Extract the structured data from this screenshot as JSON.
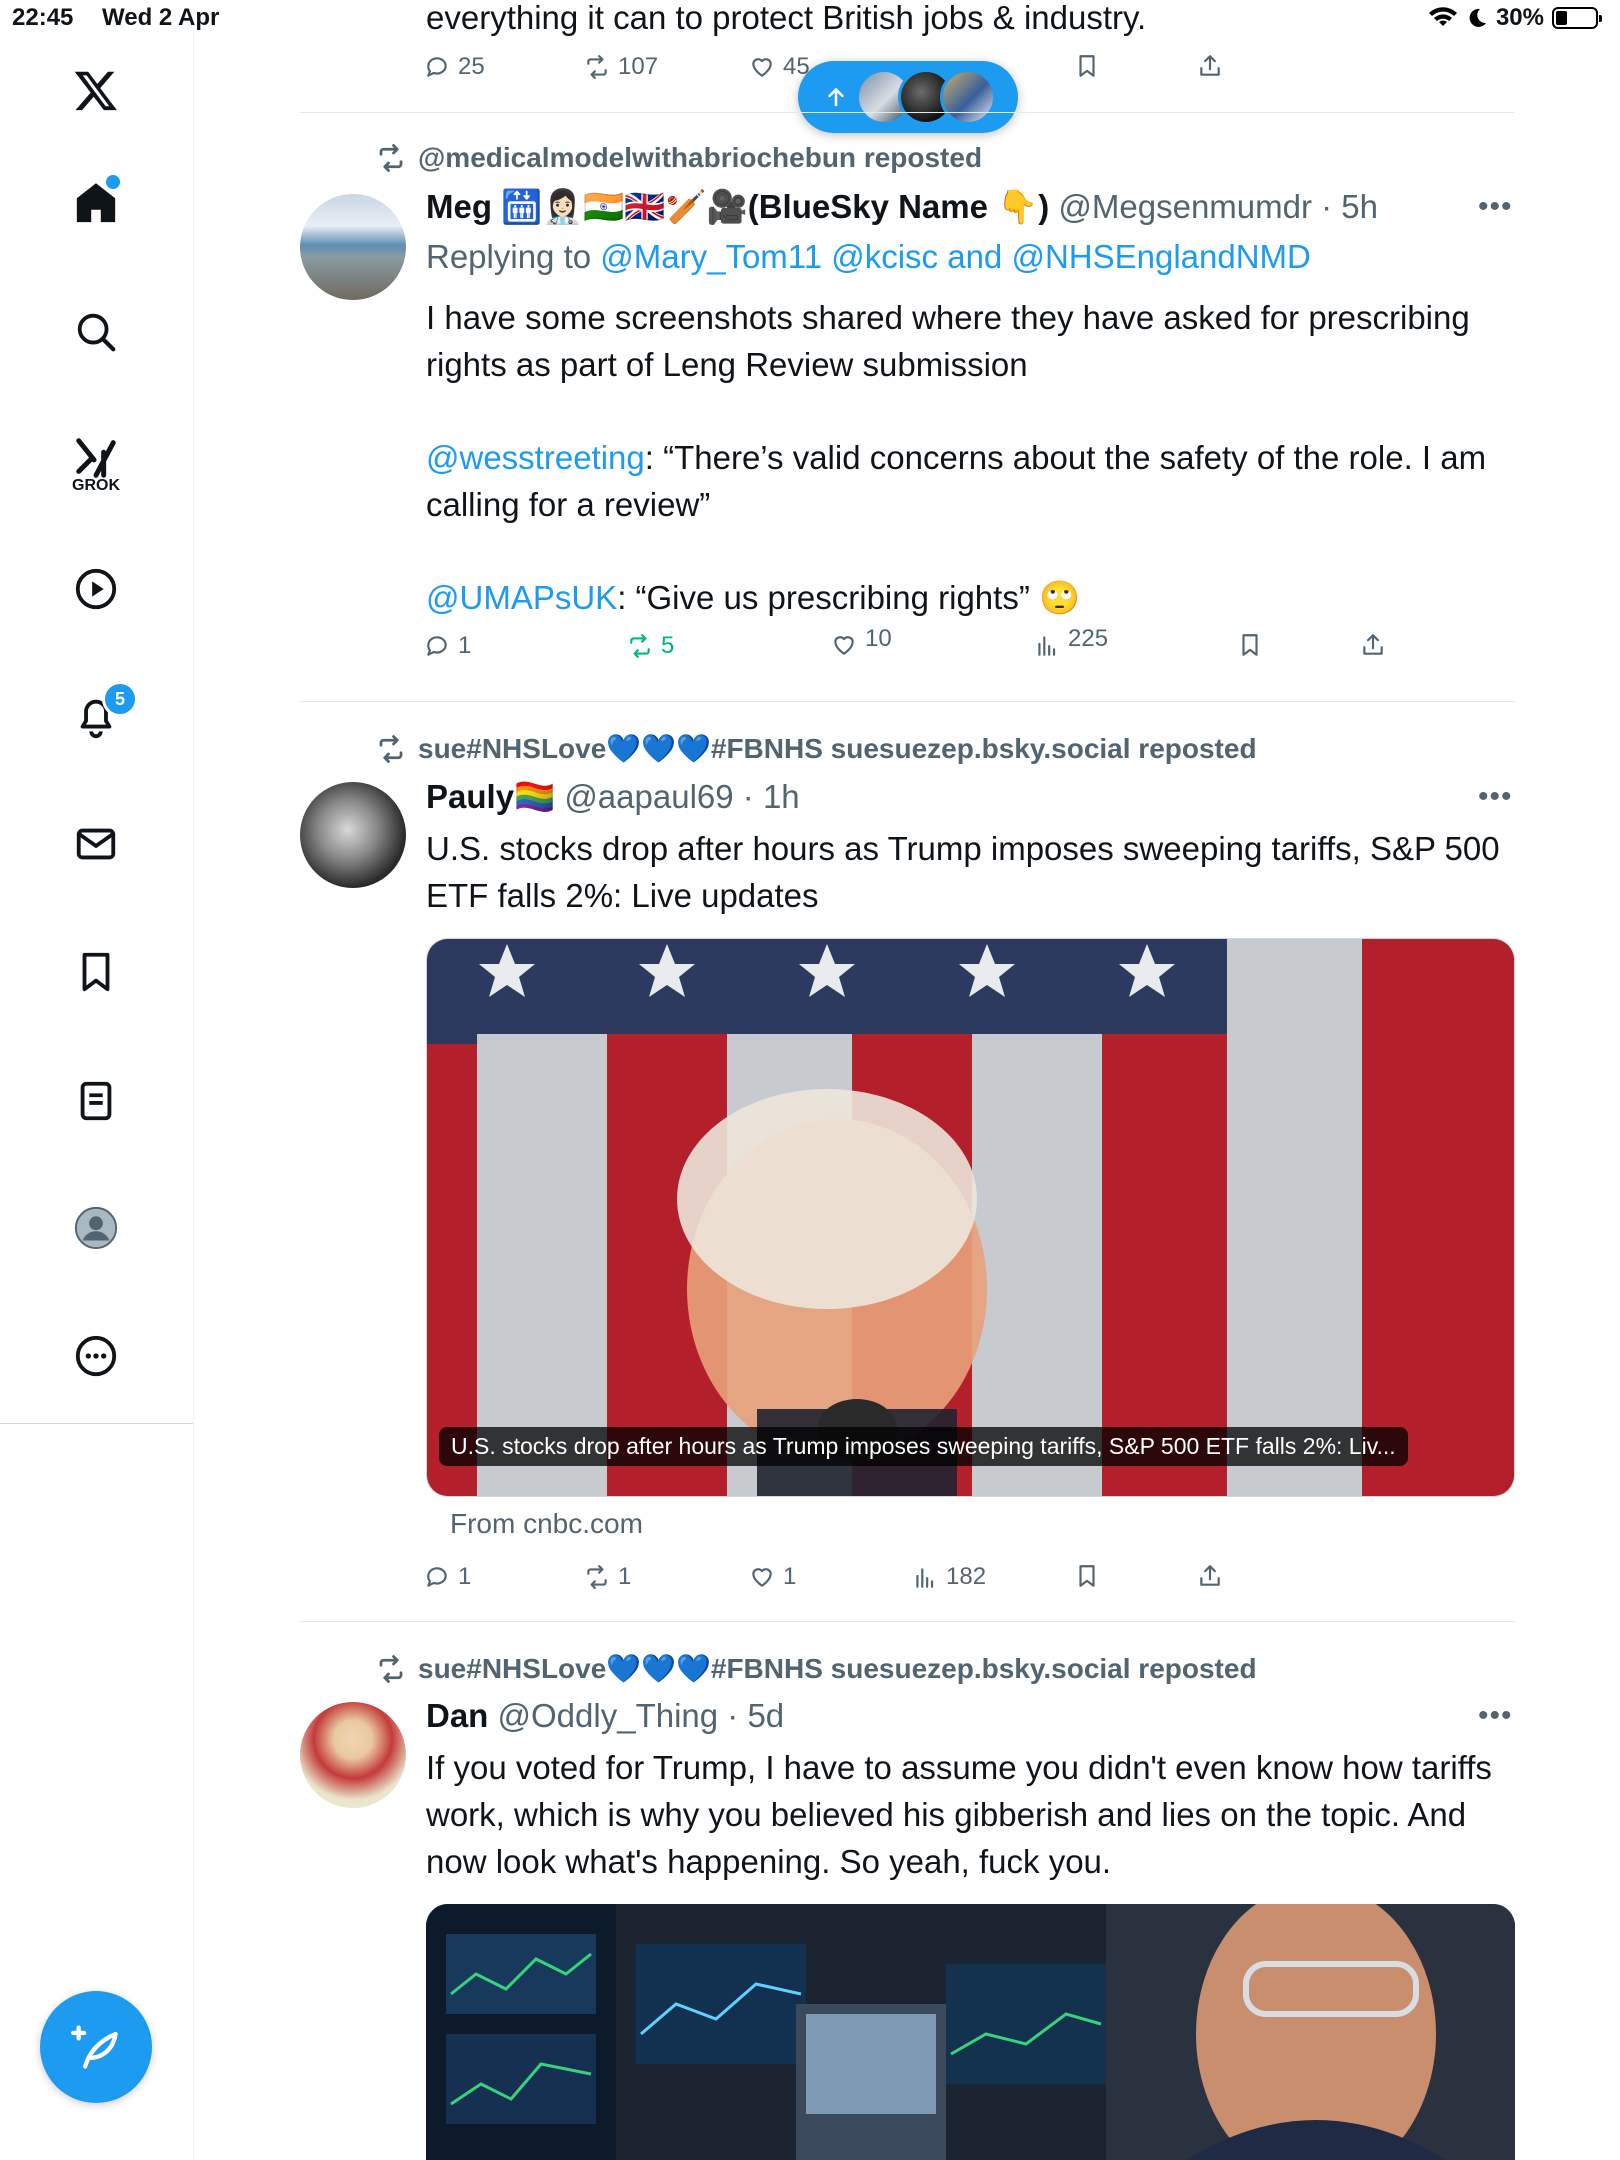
{
  "status_bar": {
    "time": "22:45",
    "date": "Wed 2 Apr",
    "battery": "30%",
    "battery_level": 0.3
  },
  "sidebar": {
    "logo": "x-logo-icon",
    "items": [
      {
        "name": "home",
        "icon": "home-icon"
      },
      {
        "name": "search",
        "icon": "search-icon"
      },
      {
        "name": "grok",
        "icon": "grok-icon",
        "label": "GROK"
      },
      {
        "name": "video",
        "icon": "play-icon"
      },
      {
        "name": "notifications",
        "icon": "bell-icon",
        "badge": "5"
      },
      {
        "name": "messages",
        "icon": "mail-icon"
      },
      {
        "name": "bookmarks",
        "icon": "bookmark-icon"
      },
      {
        "name": "lists",
        "icon": "list-icon"
      },
      {
        "name": "profile",
        "icon": "profile-icon"
      },
      {
        "name": "more",
        "icon": "more-icon"
      }
    ],
    "compose_icon": "compose-icon"
  },
  "new_posts_pill": {
    "icon": "arrow-up-icon"
  },
  "colors": {
    "accent": "#1d9bf0",
    "secondary_text": "#536471",
    "repost_green": "#00ba7c"
  },
  "tweet0": {
    "text_partial": "everything it can to protect British jobs & industry.",
    "replies": "25",
    "reposts": "107",
    "likes": "45"
  },
  "tweet1": {
    "reposted_by": "@medicalmodelwithabriochebun reposted",
    "name": "Meg 🛗👩🏻‍⚕️🇮🇳🇬🇧🏏🎥(BlueSky Name 👇)",
    "handle": "@Megsenmumdr",
    "time": "5h",
    "replying_prefix": "Replying to ",
    "replying_to": "@Mary_Tom11 @kcisc and @NHSEnglandNMD",
    "line1": "I have some screenshots shared where they have asked for prescribing rights as part of Leng Review submission",
    "mention1": "@wesstreeting",
    "quote1": ": “There’s valid concerns about the safety of the role. I am calling for a review”",
    "mention2": "@UMAPsUK",
    "quote2": ": “Give us prescribing rights” 🙄",
    "replies": "1",
    "reposts": "5",
    "likes": "10",
    "views": "225"
  },
  "tweet2": {
    "reposted_by": "sue#NHSLove💙💙💙#FBNHS suesuezep.bsky.social reposted",
    "name": "Pauly🏳️‍🌈",
    "handle": "@aapaul69",
    "time": "1h",
    "text": "U.S. stocks drop after hours as Trump imposes sweeping tariffs, S&P 500 ETF falls 2%: Live updates",
    "card_caption": "U.S. stocks drop after hours as Trump imposes sweeping tariffs, S&P 500 ETF falls 2%: Liv...",
    "source": "From cnbc.com",
    "replies": "1",
    "reposts": "1",
    "likes": "1",
    "views": "182"
  },
  "tweet3": {
    "reposted_by": "sue#NHSLove💙💙💙#FBNHS suesuezep.bsky.social reposted",
    "name": "Dan",
    "handle": "@Oddly_Thing",
    "time": "5d",
    "text": "If you voted for Trump, I have to assume you didn't even know how tariffs work, which is why you believed his gibberish and lies on the topic. And now look what's happening. So yeah, fuck you."
  },
  "separator": " · ",
  "more_glyph": "•••"
}
